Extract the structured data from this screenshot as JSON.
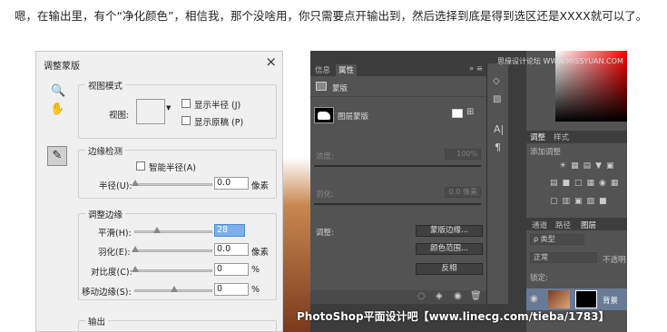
{
  "caption": "嗯，在输出里，有个“净化颜色”，相信我，那个没啥用，你只需要点开输出到，然后选择到底是得到选区还是XXXX就可以了。",
  "dialog": {
    "title": "调整蒙版",
    "close": "×",
    "view_mode": {
      "title": "视图模式",
      "view_label": "视图:",
      "show_radius": "显示半径 (J)",
      "show_original": "显示原稿 (P)"
    },
    "edge_detect": {
      "title": "边缘检测",
      "smart_radius": "智能半径(A)",
      "radius_label": "半径(U):",
      "radius_value": "0.0",
      "unit": "像素"
    },
    "adjust_edge": {
      "title": "调整边缘",
      "smooth_label": "平滑(H):",
      "smooth_value": "28",
      "feather_label": "羽化(E):",
      "feather_value": "0.0",
      "feather_unit": "像素",
      "contrast_label": "对比度(C):",
      "contrast_value": "0",
      "contrast_unit": "%",
      "shift_label": "移动边缘(S):",
      "shift_value": "0",
      "shift_unit": "%"
    },
    "output": {
      "title": "输出"
    }
  },
  "ps": {
    "tabs": [
      "信息",
      "属性"
    ],
    "mask_title": "蒙版",
    "layer_mask": "图层蒙版",
    "density_label": "浓度:",
    "density_value": "100%",
    "feather_label": "羽化:",
    "feather_value": "0.0 像素",
    "adjust_label": "调整:",
    "mask_edge_btn": "蒙版边缘...",
    "color_range_btn": "颜色范围...",
    "invert_btn": "反相",
    "right": {
      "tabs": [
        "调整",
        "样式"
      ],
      "add_adjust": "添加调整",
      "layer_tabs": [
        "通道",
        "路径",
        "图层"
      ],
      "kind": "ρ 类型",
      "blend": "正常",
      "opacity": "不透明",
      "lock": "锁定:",
      "layer_name": "背景"
    },
    "watermark": "PhotoShop平面设计吧【www.linecg.com/tieba/1783】",
    "corner_watermark": "思缘设计论坛 WWW.MISSYUAN.COM"
  }
}
